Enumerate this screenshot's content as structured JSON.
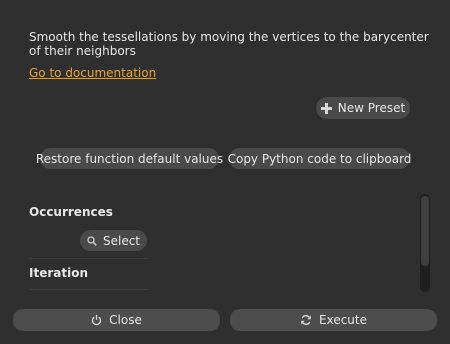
{
  "description": "Smooth the tessellations by moving the vertices to the barycenter of their neighbors",
  "doc_link": "Go to documentation",
  "presets": {
    "new_preset_label": "New Preset"
  },
  "actions": {
    "restore_label": "Restore function default values",
    "copy_label": "Copy Python code to clipboard"
  },
  "parameters": {
    "occurrences": {
      "title": "Occurrences",
      "select_label": "Select"
    },
    "iteration": {
      "title": "Iteration"
    }
  },
  "footer": {
    "close_label": "Close",
    "execute_label": "Execute"
  },
  "colors": {
    "background": "#2f2f2f",
    "button": "#4a4a4a",
    "link": "#f0a21f",
    "text": "#e8e8e8"
  },
  "icons": {
    "new_preset": "plus-icon",
    "select": "search-icon",
    "close": "power-icon",
    "execute": "refresh-icon"
  }
}
